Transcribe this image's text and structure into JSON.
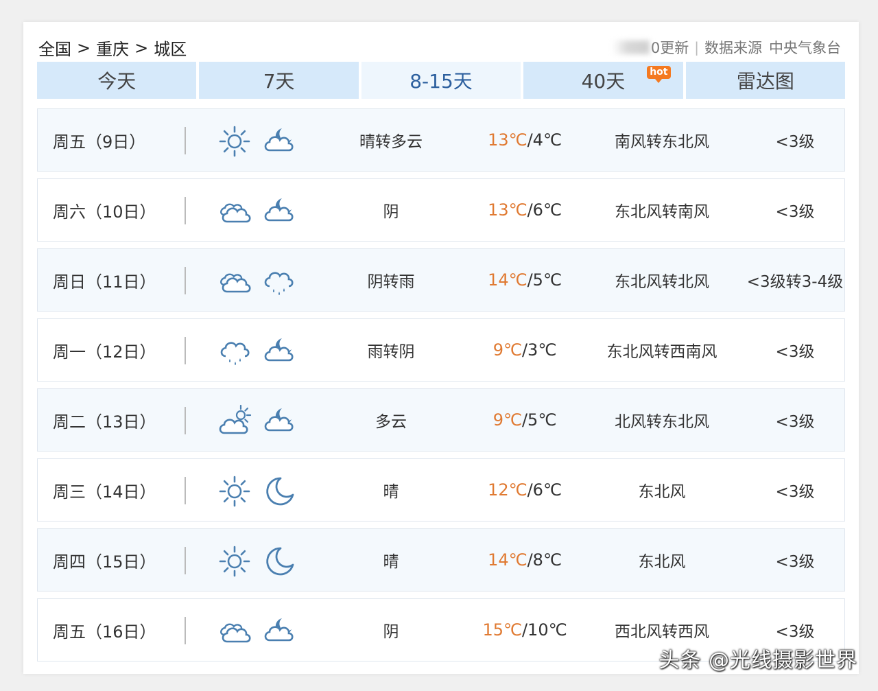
{
  "breadcrumb": {
    "items": [
      "全国",
      "重庆",
      "城区"
    ],
    "separator": ">"
  },
  "source": {
    "update_text": "0更新",
    "label": "数据来源",
    "name": "中央气象台"
  },
  "tabs": [
    {
      "label": "今天",
      "active": false
    },
    {
      "label": "7天",
      "active": false
    },
    {
      "label": "8-15天",
      "active": true
    },
    {
      "label": "40天",
      "active": false,
      "badge": "hot"
    },
    {
      "label": "雷达图",
      "active": false
    }
  ],
  "colors": {
    "tab_bg": "#d6e9fa",
    "tab_active_bg": "#eef6fd",
    "high_temp": "#e07a32",
    "icon": "#4a7fb0",
    "hot_badge": "#f47920"
  },
  "forecast": [
    {
      "date": "周五（9日）",
      "icon_day": "sun-icon",
      "icon_night": "cloud-moon-icon",
      "weather": "晴转多云",
      "high": "13℃",
      "low": "4℃",
      "wind": "南风转东北风",
      "level": "<3级"
    },
    {
      "date": "周六（10日）",
      "icon_day": "cloud-icon",
      "icon_night": "cloud-moon-icon",
      "weather": "阴",
      "high": "13℃",
      "low": "6℃",
      "wind": "东北风转南风",
      "level": "<3级"
    },
    {
      "date": "周日（11日）",
      "icon_day": "cloud-icon",
      "icon_night": "rain-cloud-icon",
      "weather": "阴转雨",
      "high": "14℃",
      "low": "5℃",
      "wind": "东北风转北风",
      "level": "<3级转3-4级"
    },
    {
      "date": "周一（12日）",
      "icon_day": "rain-cloud-icon",
      "icon_night": "cloud-moon-icon",
      "weather": "雨转阴",
      "high": "9℃",
      "low": "3℃",
      "wind": "东北风转西南风",
      "level": "<3级"
    },
    {
      "date": "周二（13日）",
      "icon_day": "cloud-sun-icon",
      "icon_night": "cloud-moon-icon",
      "weather": "多云",
      "high": "9℃",
      "low": "5℃",
      "wind": "北风转东北风",
      "level": "<3级"
    },
    {
      "date": "周三（14日）",
      "icon_day": "sun-icon",
      "icon_night": "moon-icon",
      "weather": "晴",
      "high": "12℃",
      "low": "6℃",
      "wind": "东北风",
      "level": "<3级"
    },
    {
      "date": "周四（15日）",
      "icon_day": "sun-icon",
      "icon_night": "moon-icon",
      "weather": "晴",
      "high": "14℃",
      "low": "8℃",
      "wind": "东北风",
      "level": "<3级"
    },
    {
      "date": "周五（16日）",
      "icon_day": "cloud-icon",
      "icon_night": "cloud-moon-icon",
      "weather": "阴",
      "high": "15℃",
      "low": "10℃",
      "wind": "西北风转西风",
      "level": "<3级"
    }
  ],
  "watermark": "头条 @光线摄影世界"
}
